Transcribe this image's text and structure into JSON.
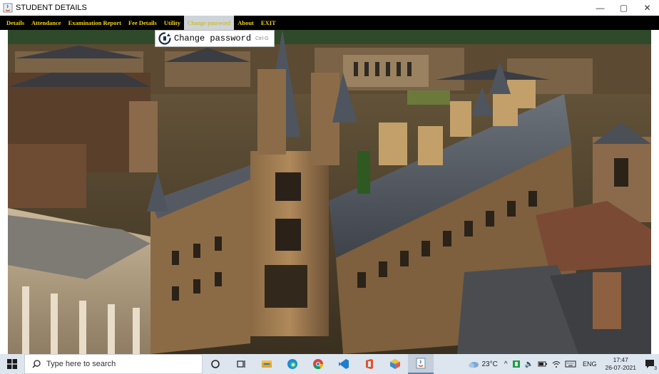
{
  "window": {
    "title": "STUDENT DETAILS",
    "controls": {
      "minimize": "—",
      "maximize": "▢",
      "close": "✕"
    }
  },
  "menubar": {
    "items": [
      {
        "label": "Details"
      },
      {
        "label": "Attendance"
      },
      {
        "label": "Examination Report"
      },
      {
        "label": "Fee Details"
      },
      {
        "label": "Utility"
      },
      {
        "label": "Change password"
      },
      {
        "label": "About"
      },
      {
        "label": "EXIT"
      }
    ],
    "active_index": 5,
    "text_color": "#f2d500",
    "background": "#000000"
  },
  "dropdown": {
    "item_label": "Change password",
    "shortcut": "Ctrl-G",
    "icon": "refresh-key-icon"
  },
  "background_image": {
    "subject": "gothic-college-buildings-aerial-photo"
  },
  "taskbar": {
    "search_placeholder": "Type here to search",
    "icons": [
      "start-icon",
      "search-icon",
      "cortana-icon",
      "task-view-icon",
      "file-explorer-icon",
      "edge-icon",
      "chrome-icon",
      "vscode-icon",
      "office-icon",
      "app-cube-icon",
      "java-app-icon"
    ],
    "weather": "23°C",
    "language": "ENG",
    "time": "17:47",
    "date": "26-07-2021",
    "notification_count": "3"
  }
}
